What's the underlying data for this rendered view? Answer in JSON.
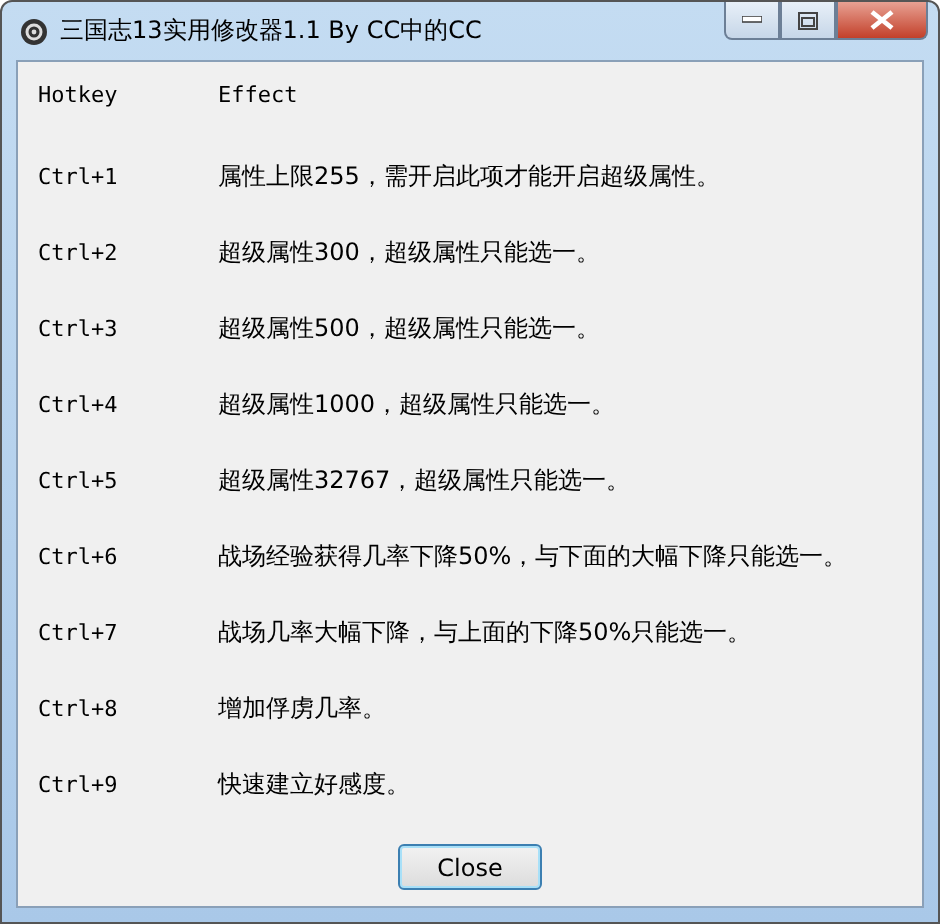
{
  "window": {
    "title": "三国志13实用修改器1.1 By CC中的CC"
  },
  "table": {
    "columns": [
      "Hotkey",
      "Effect"
    ],
    "rows": [
      {
        "hotkey": "Ctrl+1",
        "effect": "属性上限255，需开启此项才能开启超级属性。"
      },
      {
        "hotkey": "Ctrl+2",
        "effect": "超级属性300，超级属性只能选一。"
      },
      {
        "hotkey": "Ctrl+3",
        "effect": "超级属性500，超级属性只能选一。"
      },
      {
        "hotkey": "Ctrl+4",
        "effect": "超级属性1000，超级属性只能选一。"
      },
      {
        "hotkey": "Ctrl+5",
        "effect": "超级属性32767，超级属性只能选一。"
      },
      {
        "hotkey": "Ctrl+6",
        "effect": "战场经验获得几率下降50%，与下面的大幅下降只能选一。"
      },
      {
        "hotkey": "Ctrl+7",
        "effect": "战场几率大幅下降，与上面的下降50%只能选一。"
      },
      {
        "hotkey": "Ctrl+8",
        "effect": "增加俘虏几率。"
      },
      {
        "hotkey": "Ctrl+9",
        "effect": "快速建立好感度。"
      }
    ]
  },
  "buttons": [
    "Close"
  ]
}
